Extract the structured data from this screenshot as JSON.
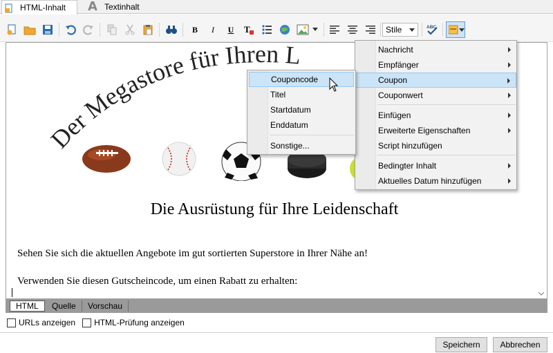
{
  "tabs": {
    "html_tab": "HTML-Inhalt",
    "text_tab": "Textinhalt",
    "text_tab_glyph": "A"
  },
  "toolbar": {
    "bold": "B",
    "italic": "I",
    "underline": "U",
    "style_select": "Stile",
    "spellcheck_label": "ABC"
  },
  "editor": {
    "headline": "Der Megastore für Ihren L",
    "subheading": "Die Ausrüstung für Ihre Leidenschaft",
    "paragraph1": "Sehen Sie sich die aktuellen Angebote im gut sortierten Superstore in Ihrer Nähe an!",
    "paragraph2": "Verwenden Sie diesen Gutscheincode, um einen Rabatt zu erhalten:"
  },
  "view_tabs": [
    "HTML",
    "Quelle",
    "Vorschau"
  ],
  "options": {
    "show_urls": "URLs anzeigen",
    "show_html_check": "HTML-Prüfung anzeigen"
  },
  "buttons": {
    "save": "Speichern",
    "cancel": "Abbrechen"
  },
  "main_menu": {
    "items": [
      {
        "label": "Nachricht",
        "submenu": true
      },
      {
        "label": "Empfänger",
        "submenu": true
      },
      {
        "label": "Coupon",
        "submenu": true,
        "highlighted": true
      },
      {
        "label": "Couponwert",
        "submenu": true
      },
      {
        "label": "Einfügen",
        "submenu": true
      },
      {
        "label": "Erweiterte Eigenschaften",
        "submenu": true
      },
      {
        "label": "Script hinzufügen",
        "submenu": false
      },
      {
        "label": "Bedingter Inhalt",
        "submenu": true
      },
      {
        "label": "Aktuelles Datum hinzufügen",
        "submenu": true
      }
    ]
  },
  "coupon_menu": {
    "items": [
      {
        "label": "Couponcode",
        "highlighted": true
      },
      {
        "label": "Titel"
      },
      {
        "label": "Startdatum"
      },
      {
        "label": "Enddatum"
      },
      {
        "label": "Sonstige..."
      }
    ]
  },
  "colors": {
    "menu_highlight": "#cce4f7",
    "menu_highlight_border": "#99c9ef",
    "toolbar_blue": "#2b6cb0",
    "view_tab_strip": "#9a9a9a"
  }
}
